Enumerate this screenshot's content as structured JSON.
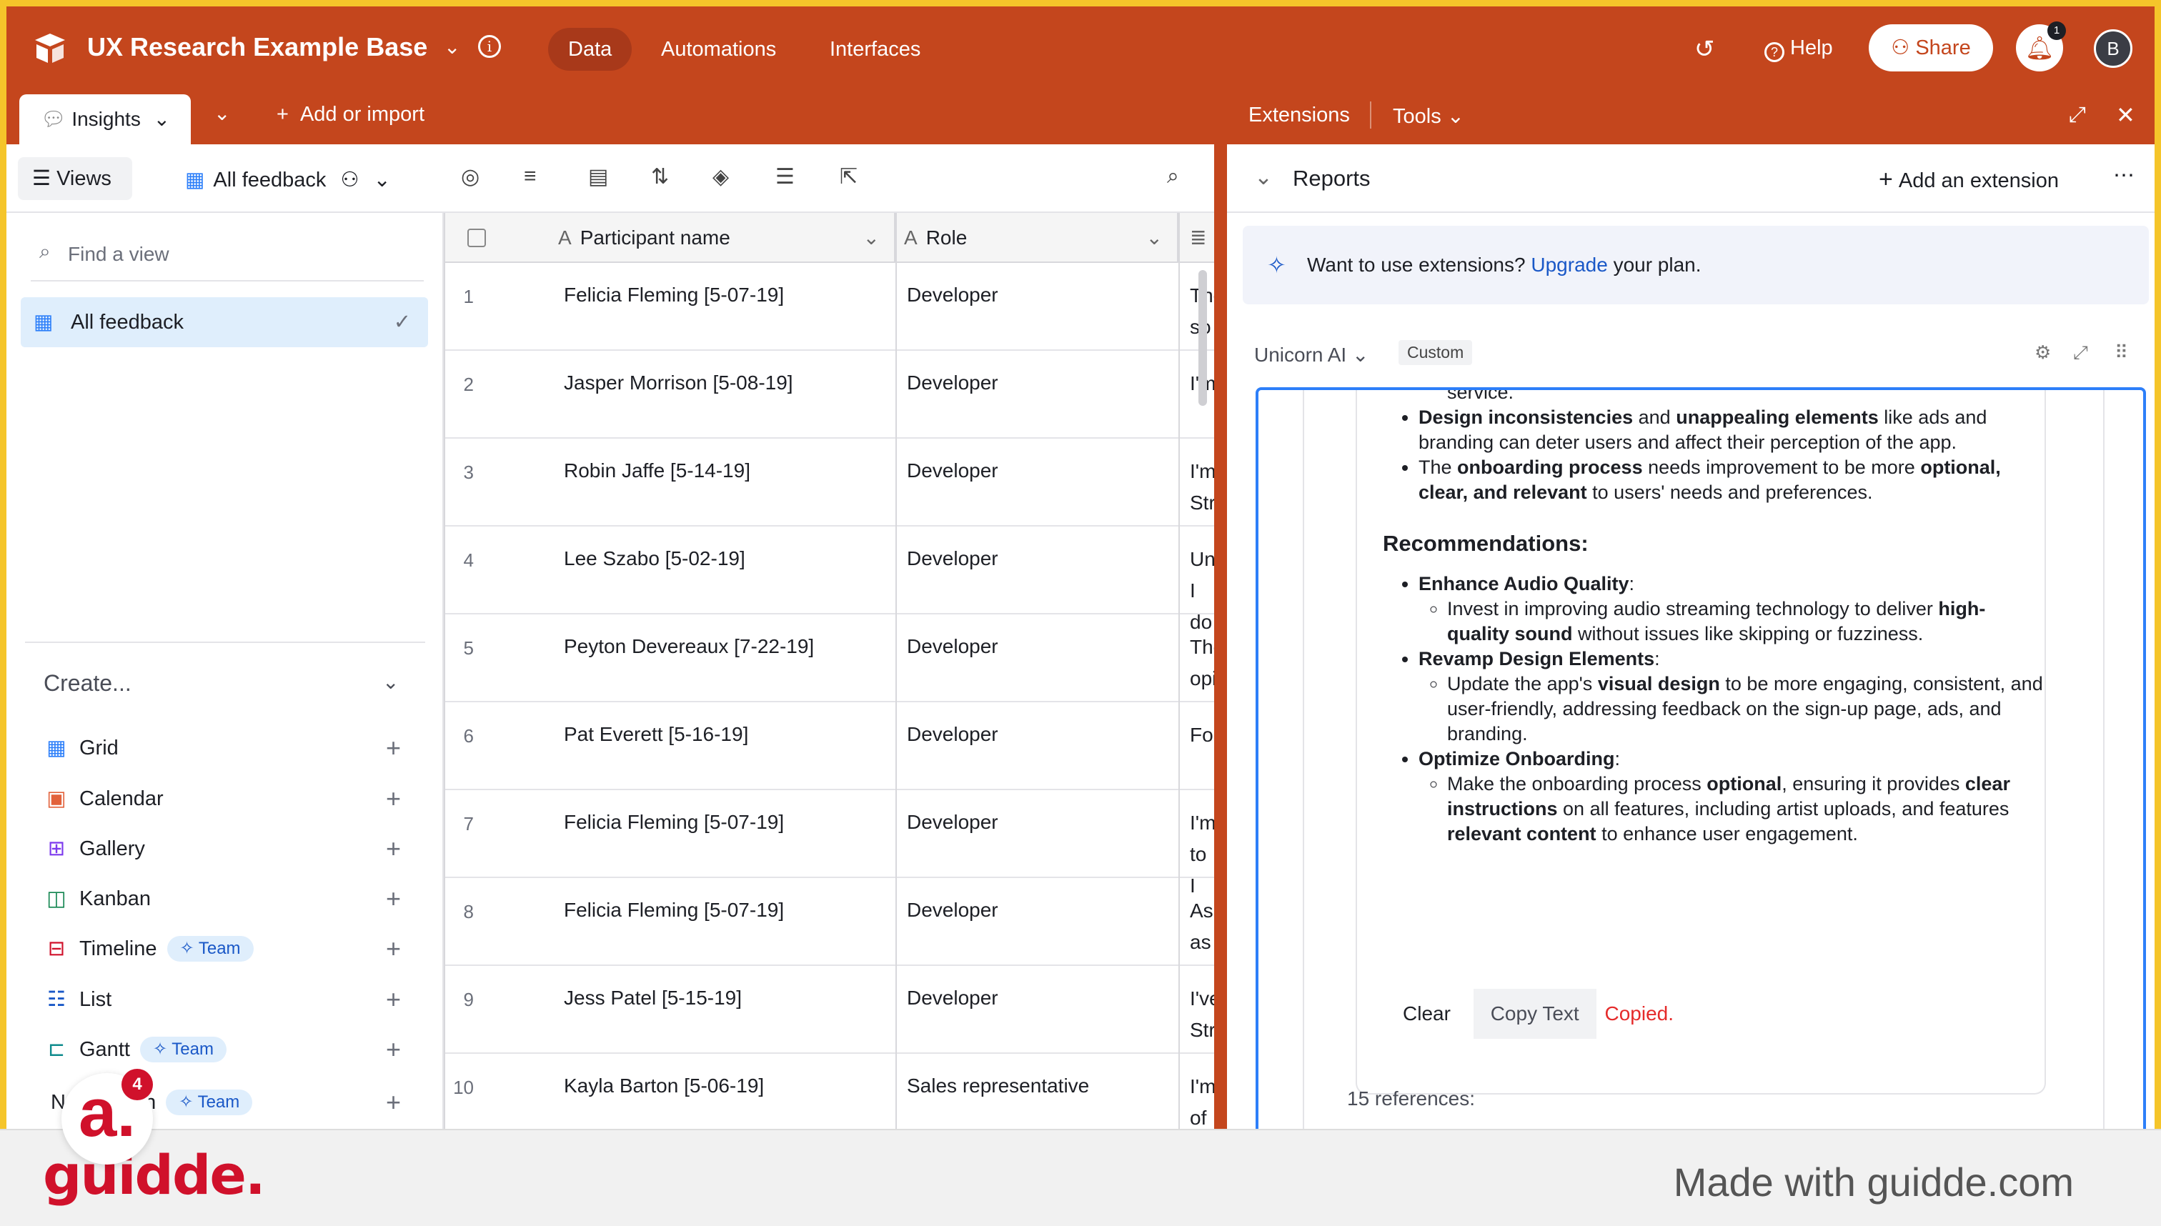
{
  "header": {
    "base_title": "UX Research Example Base",
    "nav": [
      "Data",
      "Automations",
      "Interfaces"
    ],
    "help": "Help",
    "share": "Share",
    "notification_count": "1",
    "avatar_initial": "B",
    "accent_color": "#c4461d"
  },
  "table_tabs": {
    "insights": "Insights",
    "add_import": "Add or import"
  },
  "viewbar": {
    "views": "Views",
    "current_view": "All feedback"
  },
  "sidebar": {
    "find_placeholder": "Find a view",
    "selected_view": "All feedback",
    "create_heading": "Create...",
    "items": [
      {
        "label": "Grid",
        "icon": "grid-icon",
        "badge": ""
      },
      {
        "label": "Calendar",
        "icon": "calendar-icon",
        "badge": ""
      },
      {
        "label": "Gallery",
        "icon": "gallery-icon",
        "badge": ""
      },
      {
        "label": "Kanban",
        "icon": "kanban-icon",
        "badge": ""
      },
      {
        "label": "Timeline",
        "icon": "timeline-icon",
        "badge": "Team"
      },
      {
        "label": "List",
        "icon": "list-icon",
        "badge": ""
      },
      {
        "label": "Gantt",
        "icon": "gantt-icon",
        "badge": "Team"
      },
      {
        "label": "Ne",
        "icon": "new-icon",
        "badge": "Team"
      }
    ],
    "last_item_tail": "n"
  },
  "grid": {
    "columns": [
      "Participant name",
      "Role"
    ],
    "rows": [
      {
        "num": "1",
        "name": "Felicia Fleming [5-07-19]",
        "role": "Developer",
        "notes": "The so"
      },
      {
        "num": "2",
        "name": "Jasper Morrison [5-08-19]",
        "role": "Developer",
        "notes": "I'm"
      },
      {
        "num": "3",
        "name": "Robin Jaffe [5-14-19]",
        "role": "Developer",
        "notes": "I'm Str"
      },
      {
        "num": "4",
        "name": "Lee Szabo [5-02-19]",
        "role": "Developer",
        "notes": "Un I do"
      },
      {
        "num": "5",
        "name": "Peyton Devereaux [7-22-19]",
        "role": "Developer",
        "notes": "The opi"
      },
      {
        "num": "6",
        "name": "Pat Everett [5-16-19]",
        "role": "Developer",
        "notes": "For"
      },
      {
        "num": "7",
        "name": "Felicia Fleming [5-07-19]",
        "role": "Developer",
        "notes": "I'm to I"
      },
      {
        "num": "8",
        "name": "Felicia Fleming [5-07-19]",
        "role": "Developer",
        "notes": "As as"
      },
      {
        "num": "9",
        "name": "Jess Patel [5-15-19]",
        "role": "Developer",
        "notes": "I've Str"
      },
      {
        "num": "10",
        "name": "Kayla Barton [5-06-19]",
        "role": "Sales representative",
        "notes": "I'm of t"
      }
    ]
  },
  "extensions": {
    "tab": "Extensions",
    "tools": "Tools",
    "reports": "Reports",
    "add_extension": "Add an extension",
    "upgrade_pre": "Want to use extensions?",
    "upgrade_link": "Upgrade",
    "upgrade_post": "your plan.",
    "unicorn": "Unicorn AI",
    "custom": "Custom",
    "ai": {
      "service_tail": "service.",
      "b1_bold1": "Design inconsistencies",
      "b1_mid": "and",
      "b1_bold2": "unappealing elements",
      "b1_rest": "like ads and branding can deter users and affect their perception of the app.",
      "b2_pre": "The",
      "b2_bold1": "onboarding process",
      "b2_mid": "needs improvement to be more",
      "b2_bold2": "optional, clear, and relevant",
      "b2_rest": "to users' needs and preferences.",
      "rec_heading": "Recommendations:",
      "r1_title": "Enhance Audio Quality",
      "r1_pre": "Invest in improving audio streaming technology to deliver",
      "r1_bold": "high-quality sound",
      "r1_rest": "without issues like skipping or fuzziness.",
      "r2_title": "Revamp Design Elements",
      "r2_pre": "Update the app's",
      "r2_bold": "visual design",
      "r2_rest": "to be more engaging, consistent, and user-friendly, addressing feedback on the sign-up page, ads, and branding.",
      "r3_title": "Optimize Onboarding",
      "r3_pre": "Make the onboarding process",
      "r3_bold1": "optional",
      "r3_mid": ", ensuring it provides",
      "r3_bold2": "clear instructions",
      "r3_mid2": "on all features, including artist uploads, and features",
      "r3_bold3": "relevant content",
      "r3_rest": "to enhance user engagement.",
      "colon": ":"
    },
    "clear": "Clear",
    "copy_text": "Copy Text",
    "copied": "Copied.",
    "references": "15 references:"
  },
  "footer": {
    "brand": "guidde.",
    "made_with": "Made with guidde.com",
    "avatar_letter": "a.",
    "avatar_badge": "4"
  }
}
